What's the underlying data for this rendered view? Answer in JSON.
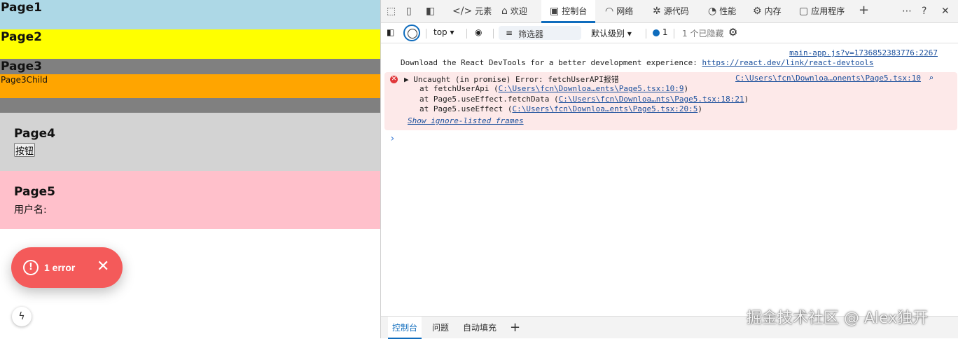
{
  "app": {
    "page1": "Page1",
    "page2": "Page2",
    "page3": "Page3",
    "page3child": "Page3Child",
    "page4": "Page4",
    "page4_button": "按钮",
    "page5": "Page5",
    "page5_username": "用户名:"
  },
  "toast": {
    "label": "1 error"
  },
  "devtools": {
    "tabs": [
      "元素",
      "欢迎",
      "控制台",
      "网络",
      "源代码",
      "性能",
      "内存",
      "应用程序"
    ],
    "context": "top",
    "filter_placeholder": "筛选器",
    "level": "默认级别",
    "issue_count": "1",
    "hidden": "1 个已隐藏",
    "console": {
      "source1": "main-app.js?v=1736852383776:2267",
      "message1": "Download the React DevTools for a better development experience: ",
      "message1_link": "https://react.dev/link/react-devtools",
      "error_title": "Uncaught (in promise) Error: fetchUserAPI报错",
      "error_source": "C:\\Users\\fcn\\Downloa…onents\\Page5.tsx:10",
      "stack": [
        {
          "prefix": "at fetchUserApi (",
          "link": "C:\\Users\\fcn\\Downloa…ents\\Page5.tsx:10:9",
          "suffix": ")"
        },
        {
          "prefix": "at Page5.useEffect.fetchData (",
          "link": "C:\\Users\\fcn\\Downloa…nts\\Page5.tsx:18:21",
          "suffix": ")"
        },
        {
          "prefix": "at Page5.useEffect (",
          "link": "C:\\Users\\fcn\\Downloa…ents\\Page5.tsx:20:5",
          "suffix": ")"
        }
      ],
      "ignore_listed": "Show ignore-listed frames"
    },
    "drawer_tabs": [
      "控制台",
      "问题",
      "自动填充"
    ]
  },
  "watermark": "掘金技术社区 @ Alex独开",
  "colors": {
    "page1": "#add8e6",
    "page2": "#ffff00",
    "page3": "#808080",
    "page3child": "#ffa500",
    "page4": "#d3d3d3",
    "page5": "#ffc0cb",
    "toast": "#f45a5a",
    "accent": "#0f6cbd"
  }
}
